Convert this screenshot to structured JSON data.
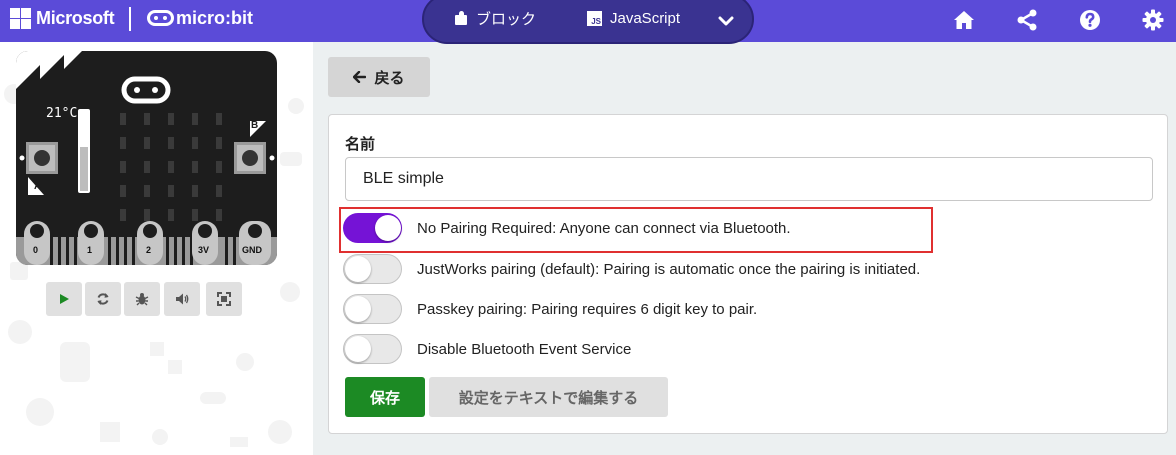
{
  "header": {
    "brand": "Microsoft",
    "product": "micro:bit",
    "tabs": [
      {
        "label": "ブロック",
        "icon": "puzzle-icon"
      },
      {
        "label": "JavaScript",
        "icon": "js-icon",
        "icon_text": "JS"
      }
    ],
    "toolbar_icons": [
      "home-icon",
      "share-icon",
      "help-icon",
      "settings-icon"
    ],
    "colors": {
      "header_bg": "#5b4bd8",
      "toggle_bg": "#3a3391"
    }
  },
  "simulator": {
    "temperature": "21°C",
    "button_a": "A",
    "button_b": "B",
    "pins": [
      "0",
      "1",
      "2",
      "3V",
      "GND"
    ],
    "controls": [
      "play-icon",
      "restart-icon",
      "debug-icon",
      "mute-icon",
      "fullscreen-icon"
    ]
  },
  "back_button": {
    "label": "戻る"
  },
  "form": {
    "name_label": "名前",
    "name_value": "BLE simple",
    "options": [
      {
        "label": "No Pairing Required: Anyone can connect via Bluetooth.",
        "on": true
      },
      {
        "label": "JustWorks pairing (default): Pairing is automatic once the pairing is initiated.",
        "on": false
      },
      {
        "label": "Passkey pairing: Pairing requires 6 digit key to pair.",
        "on": false
      },
      {
        "label": "Disable Bluetooth Event Service",
        "on": false
      }
    ],
    "save_label": "保存",
    "edit_text_label": "設定をテキストで編集する",
    "colors": {
      "toggle_on": "#7513d6",
      "save": "#1c8a24",
      "highlight": "#e03030"
    }
  }
}
